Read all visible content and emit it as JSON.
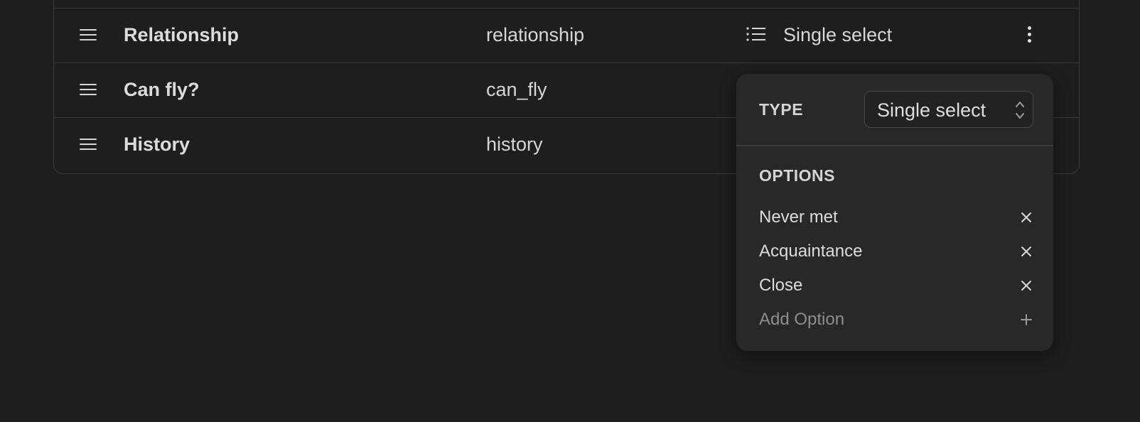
{
  "fields": [
    {
      "name": "Relationship",
      "key": "relationship",
      "type": "Single select",
      "type_icon": "list-icon",
      "show_type": true
    },
    {
      "name": "Can fly?",
      "key": "can_fly"
    },
    {
      "name": "History",
      "key": "history"
    }
  ],
  "popover": {
    "type_label": "TYPE",
    "type_value": "Single select",
    "options_label": "OPTIONS",
    "options": [
      "Never met",
      "Acquaintance",
      "Close"
    ],
    "add_label": "Add Option"
  },
  "colors": {
    "background": "#1e1e1e",
    "popover": "#282828",
    "border": "#3a3a3a",
    "muted_text": "#8e8e8e"
  }
}
